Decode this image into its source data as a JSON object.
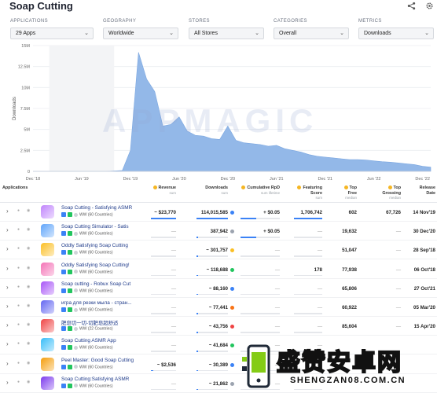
{
  "page": {
    "title": "Soap Cutting",
    "share_icon": "share-icon",
    "settings_icon": "gear-icon"
  },
  "filters": [
    {
      "label": "APPLICATIONS",
      "value": "29 Apps"
    },
    {
      "label": "GEOGRAPHY",
      "value": "Worldwide"
    },
    {
      "label": "STORES",
      "value": "All Stores"
    },
    {
      "label": "CATEGORIES",
      "value": "Overall"
    },
    {
      "label": "METRICS",
      "value": "Downloads"
    }
  ],
  "watermark": "APPMAGIC",
  "chart_data": {
    "type": "area",
    "ylabel": "Downloads",
    "ylim": [
      0,
      15000000
    ],
    "yticks": [
      "0",
      "2.5M",
      "5M",
      "7.5M",
      "10M",
      "12.5M",
      "15M"
    ],
    "xticks": [
      "Dec '18",
      "Jun '19",
      "Dec '19",
      "Jun '20",
      "Dec '20",
      "Jun '21",
      "Dec '21",
      "Jun '22",
      "Dec '22"
    ],
    "grid": true,
    "x": [
      "2018-12",
      "2019-03",
      "2019-06",
      "2019-09",
      "2019-11",
      "2019-12",
      "2020-01",
      "2020-02",
      "2020-03",
      "2020-04",
      "2020-05",
      "2020-06",
      "2020-07",
      "2020-08",
      "2020-09",
      "2020-10",
      "2020-11",
      "2020-12",
      "2021-01",
      "2021-02",
      "2021-03",
      "2021-04",
      "2021-05",
      "2021-06",
      "2021-07",
      "2021-08",
      "2021-09",
      "2021-10",
      "2021-11",
      "2021-12",
      "2022-01",
      "2022-02",
      "2022-03",
      "2022-04",
      "2022-05",
      "2022-06",
      "2022-07",
      "2022-08",
      "2022-09",
      "2022-10",
      "2022-11",
      "2022-12",
      "2023-01"
    ],
    "values": [
      0,
      0,
      0,
      0,
      100000,
      2500000,
      14200000,
      11000000,
      9500000,
      5400000,
      5600000,
      6500000,
      4800000,
      4300000,
      4200000,
      3900000,
      3800000,
      5400000,
      3700000,
      3400000,
      3300000,
      3200000,
      3000000,
      3100000,
      2700000,
      2500000,
      2300000,
      2000000,
      1800000,
      1700000,
      1600000,
      1500000,
      1400000,
      1400000,
      1350000,
      1250000,
      1150000,
      1100000,
      1000000,
      900000,
      800000,
      600000,
      500000
    ],
    "color": "#93b8e8"
  },
  "table": {
    "headers": {
      "applications": "Applications",
      "revenue": "Revenue",
      "revenue_sub": "sum",
      "downloads": "Downloads",
      "downloads_sub": "sum",
      "rpd": "Cumulative RpD",
      "rpd_sub": "sum lifetime",
      "featuring": "Featuring Score",
      "featuring_sub": "sum",
      "top_free": "Top Free",
      "top_free_sub": "median",
      "top_grossing": "Top Grossing",
      "top_grossing_sub": "median",
      "release": "Release Date"
    },
    "rows": [
      {
        "name": "Soap Cutting - Satisfying ASMR",
        "meta": "WW (60 Countries)",
        "revenue": "~ $23,770",
        "downloads": "114,015,585",
        "rpd": "+ $0.05",
        "featuring": "1,706,742",
        "top_free": "602",
        "top_grossing": "67,726",
        "release": "14 Nov'19",
        "icon_color": "#c084fc",
        "dot": "#3b82f6",
        "dl_fill": 1.0
      },
      {
        "name": "Soap Cutting Simulator - Satis",
        "meta": "WW (60 Countries)",
        "revenue": "—",
        "downloads": "387,942",
        "rpd": "+ $0.05",
        "featuring": "—",
        "top_free": "19,632",
        "top_grossing": "—",
        "release": "30 Dec'20",
        "icon_color": "#60a5fa",
        "dot": "#9ca3af",
        "dl_fill": 0.05
      },
      {
        "name": "Oddly Satisfying Soap Cutting",
        "meta": "WW (60 Countries)",
        "revenue": "—",
        "downloads": "~ 301,757",
        "rpd": "—",
        "featuring": "—",
        "top_free": "51,047",
        "top_grossing": "—",
        "release": "28 Sep'18",
        "icon_color": "#fbbf24",
        "dot": "#fbbf24",
        "dl_fill": 0.04
      },
      {
        "name": "Oddly Satisfying Soap Cutting!",
        "meta": "WW (60 Countries)",
        "revenue": "—",
        "downloads": "~ 118,688",
        "rpd": "—",
        "featuring": "178",
        "top_free": "77,938",
        "top_grossing": "—",
        "release": "06 Oct'18",
        "icon_color": "#f472b6",
        "dot": "#22c55e",
        "dl_fill": 0.03
      },
      {
        "name": "Soap cutting - Robux Soap Cut",
        "meta": "WW (60 Countries)",
        "revenue": "—",
        "downloads": "~ 88,160",
        "rpd": "—",
        "featuring": "—",
        "top_free": "65,806",
        "top_grossing": "—",
        "release": "27 Oct'21",
        "icon_color": "#a855f7",
        "dot": "#3b82f6",
        "dl_fill": 0.02
      },
      {
        "name": "игра для резки мыла - стран...",
        "meta": "WW (60 Countries)",
        "revenue": "—",
        "downloads": "~ 77,441",
        "rpd": "—",
        "featuring": "—",
        "top_free": "60,922",
        "top_grossing": "—",
        "release": "05 Mar'20",
        "icon_color": "#6366f1",
        "dot": "#f97316",
        "dl_fill": 0.02
      },
      {
        "name": "肥皂切一切-切肥皂超舒适",
        "meta": "WW (22 Countries)",
        "revenue": "—",
        "downloads": "~ 43,756",
        "rpd": "—",
        "featuring": "—",
        "top_free": "85,604",
        "top_grossing": "—",
        "release": "15 Apr'20",
        "icon_color": "#ef4444",
        "dot": "#ef4444",
        "dl_fill": 0.015
      },
      {
        "name": "Soap Cutting ASMR App",
        "meta": "WW (60 Countries)",
        "revenue": "—",
        "downloads": "~ 41,684",
        "rpd": "—",
        "featuring": "—",
        "top_free": "",
        "top_grossing": "",
        "release": "",
        "icon_color": "#38bdf8",
        "dot": "#22c55e",
        "dl_fill": 0.015
      },
      {
        "name": "Peel Master: Good Soap Cutting",
        "meta": "WW (60 Countries)",
        "revenue": "~ $2,536",
        "downloads": "~ 30,389",
        "rpd": "—",
        "featuring": "",
        "top_free": "",
        "top_grossing": "",
        "release": "",
        "icon_color": "#f59e0b",
        "dot": "#3b82f6",
        "dl_fill": 0.01
      },
      {
        "name": "Soap Cutting:Satisfying ASMR",
        "meta": "WW (60 Countries)",
        "revenue": "—",
        "downloads": "~ 21,862",
        "rpd": "—",
        "featuring": "",
        "top_free": "",
        "top_grossing": "",
        "release": "",
        "icon_color": "#7c3aed",
        "dot": "#9ca3af",
        "dl_fill": 0.01
      }
    ]
  },
  "overlay_logo": {
    "text": "盛赞安卓网",
    "subtext": "SHENGZAN08.COM.CN"
  }
}
